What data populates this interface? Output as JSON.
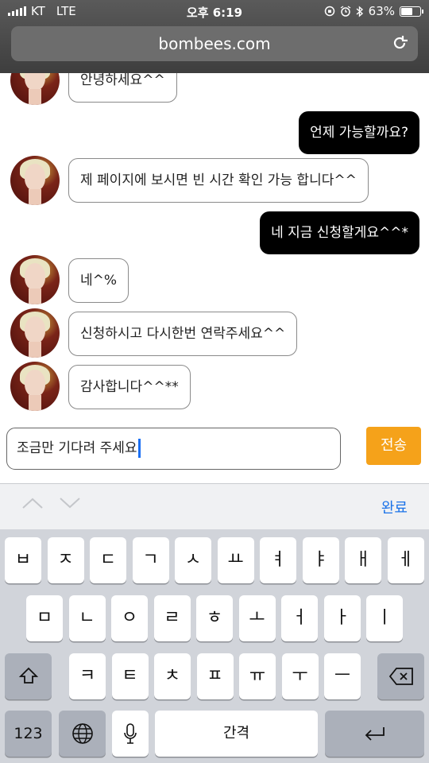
{
  "status_bar": {
    "carrier": "KT",
    "network": "LTE",
    "time": "오후 6:19",
    "battery": "63%",
    "battery_level": 0.63
  },
  "browser": {
    "url": "bombees.com"
  },
  "chat": {
    "messages": [
      {
        "side": "in",
        "text": "안녕하세요^^"
      },
      {
        "side": "out",
        "text": "언제 가능할까요?"
      },
      {
        "side": "in",
        "text": "제 페이지에 보시면 빈 시간 확인 가능 합니다^^"
      },
      {
        "side": "out",
        "text": "네 지금 신청할게요^^*"
      },
      {
        "side": "in",
        "text": "네^%"
      },
      {
        "side": "in",
        "text": "신청하시고 다시한번 연락주세요^^"
      },
      {
        "side": "in",
        "text": "감사합니다^^**"
      }
    ]
  },
  "composer": {
    "value": "조금만 기다려 주세요",
    "send_label": "전송",
    "send_color": "#f5a21a"
  },
  "keyboard": {
    "done_label": "완료",
    "row1": [
      "ㅂ",
      "ㅈ",
      "ㄷ",
      "ㄱ",
      "ㅅ",
      "ㅛ",
      "ㅕ",
      "ㅑ",
      "ㅐ",
      "ㅔ"
    ],
    "row2": [
      "ㅁ",
      "ㄴ",
      "ㅇ",
      "ㄹ",
      "ㅎ",
      "ㅗ",
      "ㅓ",
      "ㅏ",
      "ㅣ"
    ],
    "row3": [
      "ㅋ",
      "ㅌ",
      "ㅊ",
      "ㅍ",
      "ㅠ",
      "ㅜ",
      "ㅡ"
    ],
    "numbers_label": "123",
    "space_label": "간격"
  }
}
